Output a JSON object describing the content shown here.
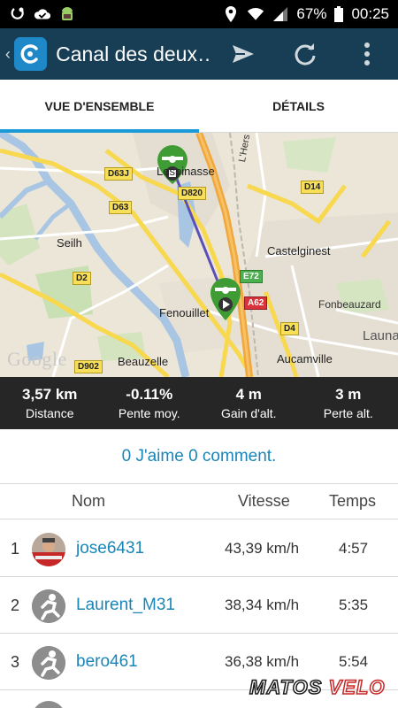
{
  "status_bar": {
    "battery": "67%",
    "time": "00:25",
    "icons": [
      "sync-icon",
      "check-cloud-icon",
      "android-icon",
      "location-icon",
      "wifi-icon",
      "signal-icon",
      "battery-icon"
    ]
  },
  "app_bar": {
    "title": "Canal des deux…",
    "actions": [
      "send-icon",
      "refresh-icon",
      "overflow-menu-icon"
    ]
  },
  "tabs": [
    {
      "label": "VUE D'ENSEMBLE",
      "active": true
    },
    {
      "label": "DÉTAILS",
      "active": false
    }
  ],
  "map": {
    "places": {
      "lespinasse": "Lespinasse",
      "castelginest": "Castelginest",
      "fonbeauzard": "Fonbeauzard",
      "fenouillet": "Fenouillet",
      "seilh": "Seilh",
      "beauzelle": "Beauzelle",
      "aucamville": "Aucamville",
      "launaguet": "Launa",
      "lhers": "L'Hers"
    },
    "roads": {
      "d63j": "D63J",
      "d63": "D63",
      "d820": "D820",
      "d14": "D14",
      "d2": "D2",
      "e72": "E72",
      "a62": "A62",
      "d4": "D4",
      "d902": "D902"
    },
    "attribution": "Google"
  },
  "stats": [
    {
      "value": "3,57 km",
      "label": "Distance"
    },
    {
      "value": "-0.11%",
      "label": "Pente moy."
    },
    {
      "value": "4 m",
      "label": "Gain d'alt."
    },
    {
      "value": "3 m",
      "label": "Perte alt."
    }
  ],
  "social": {
    "text": "0 J'aime 0 comment."
  },
  "leaderboard": {
    "headers": {
      "name": "Nom",
      "speed": "Vitesse",
      "time": "Temps"
    },
    "rows": [
      {
        "rank": "1",
        "name": "jose6431",
        "speed": "43,39 km/h",
        "time": "4:57",
        "avatar": "photo"
      },
      {
        "rank": "2",
        "name": "Laurent_M31",
        "speed": "38,34 km/h",
        "time": "5:35",
        "avatar": "default-cyclist-icon"
      },
      {
        "rank": "3",
        "name": "bero461",
        "speed": "36,38 km/h",
        "time": "5:54",
        "avatar": "default-cyclist-icon"
      }
    ]
  },
  "watermark": {
    "part1": "MATOS",
    "part2": "VELO"
  },
  "colors": {
    "app_bar": "#173e55",
    "accent": "#1a9ad6",
    "link": "#1a86b8",
    "stats_bg": "#262626",
    "route": "#5b4fb8",
    "marker": "#3f9c35"
  }
}
